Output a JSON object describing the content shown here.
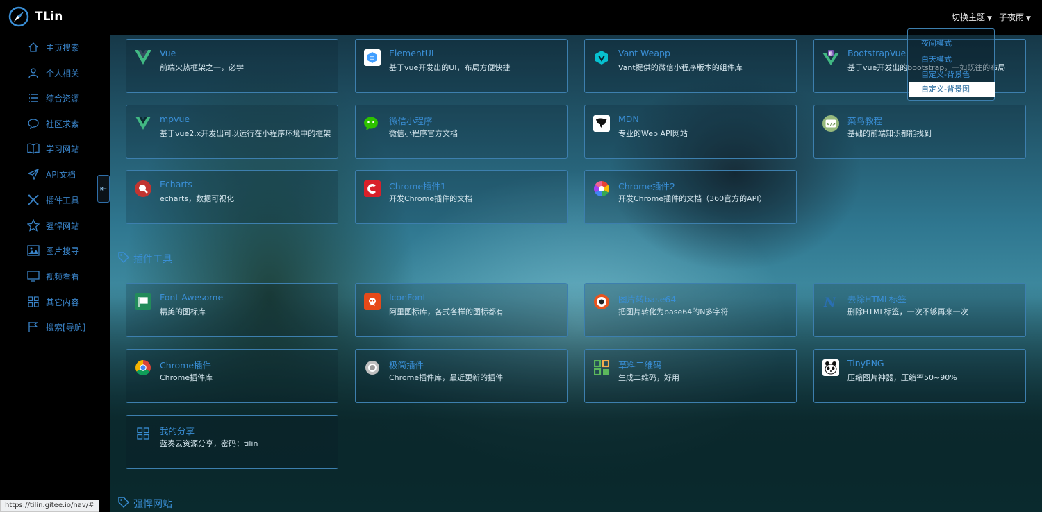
{
  "header": {
    "title": "TLin",
    "theme_label": "切换主题",
    "user_label": "子夜雨"
  },
  "theme_menu": {
    "items": [
      "夜间模式",
      "白天模式",
      "自定义-背景色",
      "自定义-背景图"
    ],
    "selected": "自定义-背景图"
  },
  "sidebar": {
    "items": [
      {
        "label": "主页搜索",
        "icon": "home-icon"
      },
      {
        "label": "个人相关",
        "icon": "user-icon"
      },
      {
        "label": "综合资源",
        "icon": "list-icon"
      },
      {
        "label": "社区求索",
        "icon": "chat-icon"
      },
      {
        "label": "学习网站",
        "icon": "book-icon"
      },
      {
        "label": "API文档",
        "icon": "send-icon"
      },
      {
        "label": "插件工具",
        "icon": "tools-icon"
      },
      {
        "label": "强悍网站",
        "icon": "star-icon"
      },
      {
        "label": "图片搜寻",
        "icon": "image-icon"
      },
      {
        "label": "视频看看",
        "icon": "monitor-icon"
      },
      {
        "label": "其它内容",
        "icon": "grid-icon"
      },
      {
        "label": "搜索[导航]",
        "icon": "flag-icon"
      }
    ],
    "collapse_glyph": "⇤"
  },
  "sections": {
    "plugins": "插件工具",
    "powerful": "强悍网站"
  },
  "cards": {
    "api": [
      {
        "title": "Vue",
        "desc": "前端火热框架之一，必学",
        "icon": "vue-logo-icon",
        "color": "#41b883"
      },
      {
        "title": "ElementUI",
        "desc": "基于vue开发出的UI，布局方便快捷",
        "icon": "elementui-logo-icon",
        "color": "#409eff"
      },
      {
        "title": "Vant Weapp",
        "desc": "Vant提供的微信小程序版本的组件库",
        "icon": "vant-logo-icon",
        "color": "#07c1d0"
      },
      {
        "title": "BootstrapVue",
        "desc": "基于vue开发出的bootstrap，一如既往的布局",
        "icon": "bootstrapvue-logo-icon",
        "color": "#41b883"
      },
      {
        "title": "mpvue",
        "desc": "基于vue2.x开发出可以运行在小程序环境中的框架",
        "icon": "mpvue-logo-icon",
        "color": "#41b883"
      },
      {
        "title": "微信小程序",
        "desc": "微信小程序官方文档",
        "icon": "wechat-logo-icon",
        "color": "#2dc100"
      },
      {
        "title": "MDN",
        "desc": "专业的Web API网站",
        "icon": "mdn-logo-icon",
        "color": "#000000"
      },
      {
        "title": "菜鸟教程",
        "desc": "基础的前端知识都能找到",
        "icon": "runoob-logo-icon",
        "color": "#96b97d"
      },
      {
        "title": "Echarts",
        "desc": "echarts，数据可视化",
        "icon": "echarts-logo-icon",
        "color": "#c23531"
      },
      {
        "title": "Chrome插件1",
        "desc": "开发Chrome插件的文档",
        "icon": "chrome-plugin-logo-icon",
        "color": "#d9202a"
      },
      {
        "title": "Chrome插件2",
        "desc": "开发Chrome插件的文档（360官方的API）",
        "icon": "chrome360-logo-icon",
        "color": "#f4b400"
      }
    ],
    "plugins": [
      {
        "title": "Font Awesome",
        "desc": "精美的图标库",
        "icon": "fontawesome-logo-icon",
        "color": "#228b5a"
      },
      {
        "title": "IconFont",
        "desc": "阿里图标库，各式各样的图标都有",
        "icon": "iconfont-logo-icon",
        "color": "#e64a19"
      },
      {
        "title": "图片转base64",
        "desc": "把图片转化为base64的N多字符",
        "icon": "base64-logo-icon",
        "color": "#e8541e"
      },
      {
        "title": "去除HTML标签",
        "desc": "删除HTML标签，一次不够再来一次",
        "icon": "html-strip-logo-icon",
        "color": "#2a6fb3"
      },
      {
        "title": "Chrome插件",
        "desc": "Chrome插件库",
        "icon": "chrome-logo-icon",
        "color": "#db4437"
      },
      {
        "title": "极简插件",
        "desc": "Chrome插件库，最近更新的插件",
        "icon": "jijian-logo-icon",
        "color": "#bfbfbf"
      },
      {
        "title": "草料二维码",
        "desc": "生成二维码，好用",
        "icon": "qrcode-logo-icon",
        "color": "#5cb85c"
      },
      {
        "title": "TinyPNG",
        "desc": "压缩图片神器，压缩率50~90%",
        "icon": "tinypng-logo-icon",
        "color": "#ffffff"
      },
      {
        "title": "我的分享",
        "desc": "蓝奏云资源分享，密码：tilin",
        "icon": "share-grid-icon",
        "color": "#3a8fd6"
      }
    ]
  },
  "status_url": "https://tilin.gitee.io/nav/#"
}
